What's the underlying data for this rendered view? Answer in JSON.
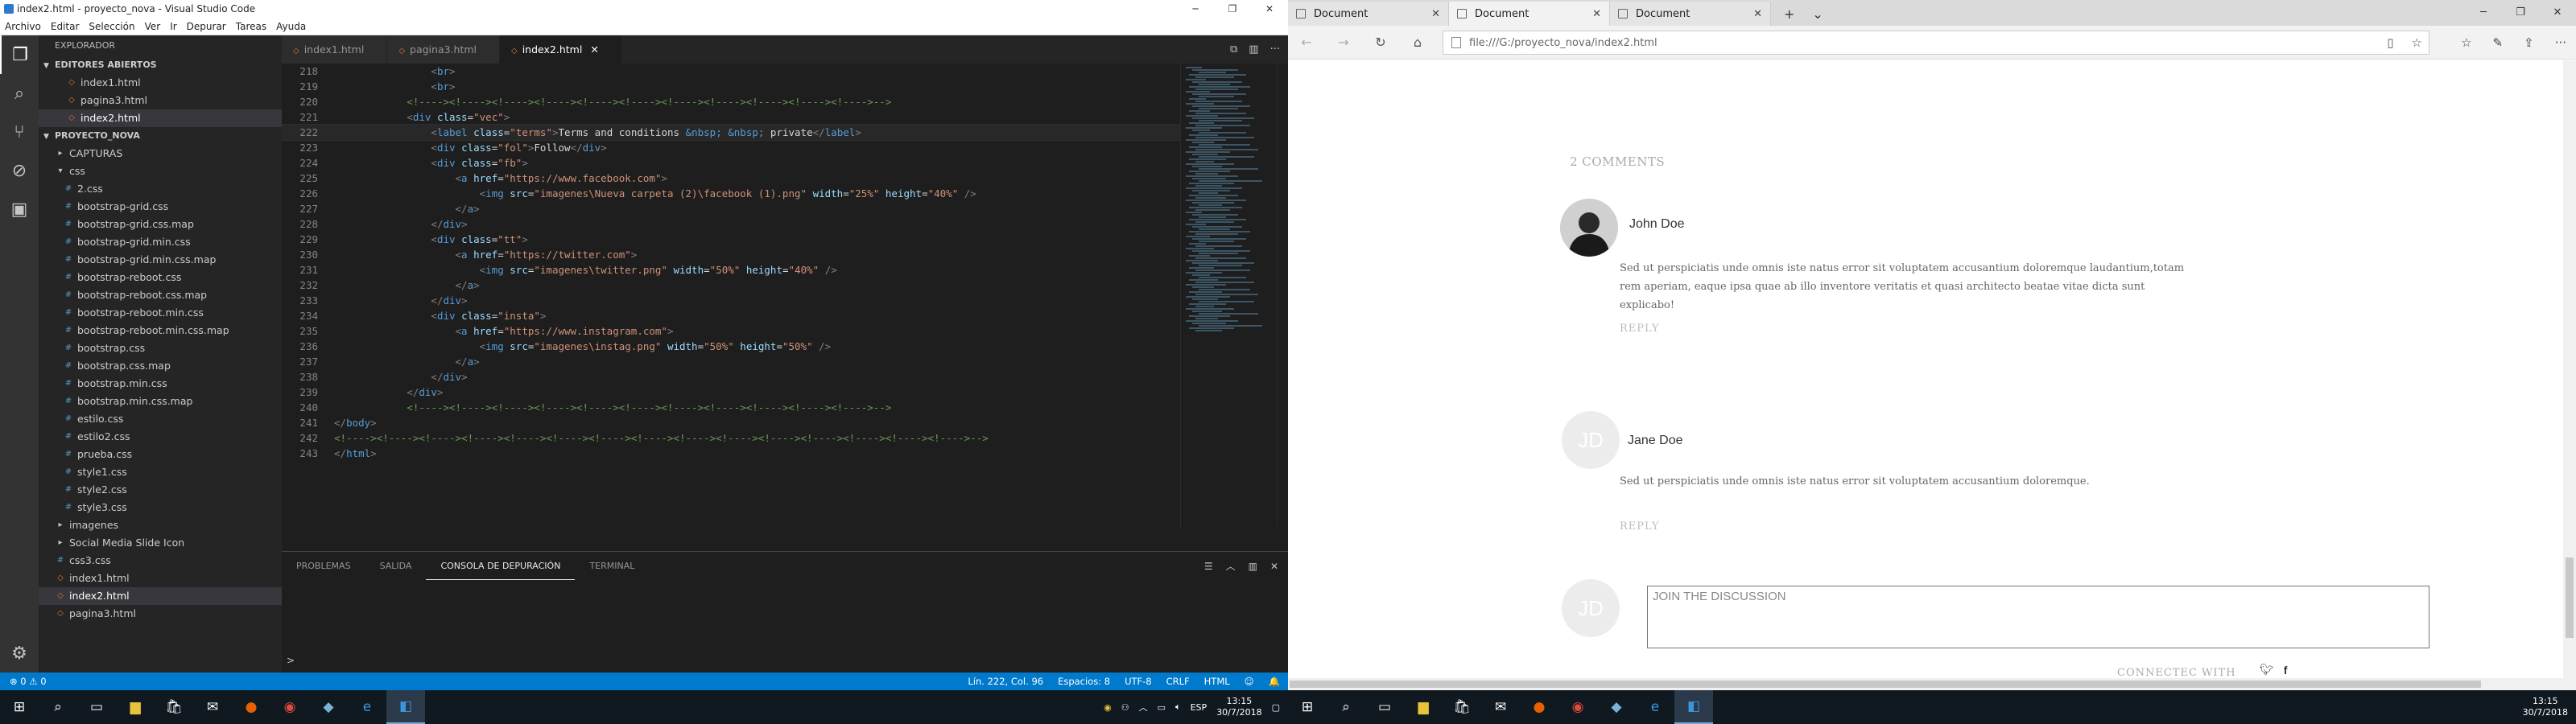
{
  "vscode": {
    "title": "index2.html - proyecto_nova - Visual Studio Code",
    "menu": [
      "Archivo",
      "Editar",
      "Selección",
      "Ver",
      "Ir",
      "Depurar",
      "Tareas",
      "Ayuda"
    ],
    "explorer_title": "EXPLORADOR",
    "open_editors_title": "EDITORES ABIERTOS",
    "open_editors": [
      "index1.html",
      "pagina3.html",
      "index2.html"
    ],
    "project_title": "PROYECTO_NOVA",
    "tree": [
      {
        "label": "CAPTURAS",
        "type": "dir",
        "depth": 1
      },
      {
        "label": "css",
        "type": "dir-open",
        "depth": 1
      },
      {
        "label": "2.css",
        "type": "css",
        "depth": 2
      },
      {
        "label": "bootstrap-grid.css",
        "type": "css",
        "depth": 2
      },
      {
        "label": "bootstrap-grid.css.map",
        "type": "css",
        "depth": 2
      },
      {
        "label": "bootstrap-grid.min.css",
        "type": "css",
        "depth": 2
      },
      {
        "label": "bootstrap-grid.min.css.map",
        "type": "css",
        "depth": 2
      },
      {
        "label": "bootstrap-reboot.css",
        "type": "css",
        "depth": 2
      },
      {
        "label": "bootstrap-reboot.css.map",
        "type": "css",
        "depth": 2
      },
      {
        "label": "bootstrap-reboot.min.css",
        "type": "css",
        "depth": 2
      },
      {
        "label": "bootstrap-reboot.min.css.map",
        "type": "css",
        "depth": 2
      },
      {
        "label": "bootstrap.css",
        "type": "css",
        "depth": 2
      },
      {
        "label": "bootstrap.css.map",
        "type": "css",
        "depth": 2
      },
      {
        "label": "bootstrap.min.css",
        "type": "css",
        "depth": 2
      },
      {
        "label": "bootstrap.min.css.map",
        "type": "css",
        "depth": 2
      },
      {
        "label": "estilo.css",
        "type": "css",
        "depth": 2
      },
      {
        "label": "estilo2.css",
        "type": "css",
        "depth": 2
      },
      {
        "label": "prueba.css",
        "type": "css",
        "depth": 2
      },
      {
        "label": "style1.css",
        "type": "css",
        "depth": 2
      },
      {
        "label": "style2.css",
        "type": "css",
        "depth": 2
      },
      {
        "label": "style3.css",
        "type": "css",
        "depth": 2
      },
      {
        "label": "imagenes",
        "type": "dir",
        "depth": 1
      },
      {
        "label": "Social Media Slide Icon",
        "type": "dir",
        "depth": 1
      },
      {
        "label": "css3.css",
        "type": "css",
        "depth": 1
      },
      {
        "label": "index1.html",
        "type": "html",
        "depth": 1
      },
      {
        "label": "index2.html",
        "type": "html",
        "depth": 1,
        "selected": true
      },
      {
        "label": "pagina3.html",
        "type": "html",
        "depth": 1
      }
    ],
    "tabs": [
      "index1.html",
      "pagina3.html",
      "index2.html"
    ],
    "active_tab": "index2.html",
    "code_lines": [
      {
        "n": "218",
        "html": "                <span class='t-punc'>&lt;</span><span class='t-tag'>br</span><span class='t-punc'>&gt;</span>"
      },
      {
        "n": "219",
        "html": "                <span class='t-punc'>&lt;</span><span class='t-tag'>br</span><span class='t-punc'>&gt;</span>"
      },
      {
        "n": "220",
        "html": "            <span class='t-com'>&lt;!----&gt;&lt;!----&gt;&lt;!----&gt;&lt;!----&gt;&lt;!----&gt;&lt;!----&gt;&lt;!----&gt;&lt;!----&gt;&lt;!----&gt;&lt;!----&gt;&lt;!----&gt;--&gt;</span>"
      },
      {
        "n": "221",
        "html": "            <span class='t-punc'>&lt;</span><span class='t-tag'>div</span> <span class='t-attr'>class</span>=<span class='t-str'>\"vec\"</span><span class='t-punc'>&gt;</span>"
      },
      {
        "n": "222",
        "html": "                <span class='t-punc'>&lt;</span><span class='t-tag'>label</span> <span class='t-attr'>class</span>=<span class='t-str'>\"terms\"</span><span class='t-punc'>&gt;</span>Terms and conditions <span class='t-ent'>&amp;nbsp;</span> <span class='t-ent'>&amp;nbsp;</span> private<span class='t-punc'>&lt;/</span><span class='t-tag'>label</span><span class='t-punc'>&gt;</span>",
        "cur": true
      },
      {
        "n": "223",
        "html": "                <span class='t-punc'>&lt;</span><span class='t-tag'>div</span> <span class='t-attr'>class</span>=<span class='t-str'>\"fol\"</span><span class='t-punc'>&gt;</span>Follow<span class='t-punc'>&lt;/</span><span class='t-tag'>div</span><span class='t-punc'>&gt;</span>"
      },
      {
        "n": "224",
        "html": "                <span class='t-punc'>&lt;</span><span class='t-tag'>div</span> <span class='t-attr'>class</span>=<span class='t-str'>\"fb\"</span><span class='t-punc'>&gt;</span>"
      },
      {
        "n": "225",
        "html": "                    <span class='t-punc'>&lt;</span><span class='t-tag'>a</span> <span class='t-attr'>href</span>=<span class='t-str'>\"https://www.facebook.com\"</span><span class='t-punc'>&gt;</span>"
      },
      {
        "n": "226",
        "html": "                        <span class='t-punc'>&lt;</span><span class='t-tag'>img</span> <span class='t-attr'>src</span>=<span class='t-str'>\"imagenes\\Nueva carpeta (2)\\facebook (1).png\"</span> <span class='t-attr'>width</span>=<span class='t-str'>\"25%\"</span> <span class='t-attr'>height</span>=<span class='t-str'>\"40%\"</span> <span class='t-punc'>/&gt;</span>"
      },
      {
        "n": "227",
        "html": "                    <span class='t-punc'>&lt;/</span><span class='t-tag'>a</span><span class='t-punc'>&gt;</span>"
      },
      {
        "n": "228",
        "html": "                <span class='t-punc'>&lt;/</span><span class='t-tag'>div</span><span class='t-punc'>&gt;</span>"
      },
      {
        "n": "229",
        "html": "                <span class='t-punc'>&lt;</span><span class='t-tag'>div</span> <span class='t-attr'>class</span>=<span class='t-str'>\"tt\"</span><span class='t-punc'>&gt;</span>"
      },
      {
        "n": "230",
        "html": "                    <span class='t-punc'>&lt;</span><span class='t-tag'>a</span> <span class='t-attr'>href</span>=<span class='t-str'>\"https://twitter.com\"</span><span class='t-punc'>&gt;</span>"
      },
      {
        "n": "231",
        "html": "                        <span class='t-punc'>&lt;</span><span class='t-tag'>img</span> <span class='t-attr'>src</span>=<span class='t-str'>\"imagenes\\twitter.png\"</span> <span class='t-attr'>width</span>=<span class='t-str'>\"50%\"</span> <span class='t-attr'>height</span>=<span class='t-str'>\"40%\"</span> <span class='t-punc'>/&gt;</span>"
      },
      {
        "n": "232",
        "html": "                    <span class='t-punc'>&lt;/</span><span class='t-tag'>a</span><span class='t-punc'>&gt;</span>"
      },
      {
        "n": "233",
        "html": "                <span class='t-punc'>&lt;/</span><span class='t-tag'>div</span><span class='t-punc'>&gt;</span>"
      },
      {
        "n": "234",
        "html": "                <span class='t-punc'>&lt;</span><span class='t-tag'>div</span> <span class='t-attr'>class</span>=<span class='t-str'>\"insta\"</span><span class='t-punc'>&gt;</span>"
      },
      {
        "n": "235",
        "html": "                    <span class='t-punc'>&lt;</span><span class='t-tag'>a</span> <span class='t-attr'>href</span>=<span class='t-str'>\"https://www.instagram.com\"</span><span class='t-punc'>&gt;</span>"
      },
      {
        "n": "236",
        "html": "                        <span class='t-punc'>&lt;</span><span class='t-tag'>img</span> <span class='t-attr'>src</span>=<span class='t-str'>\"imagenes\\instag.png\"</span> <span class='t-attr'>width</span>=<span class='t-str'>\"50%\"</span> <span class='t-attr'>height</span>=<span class='t-str'>\"50%\"</span> <span class='t-punc'>/&gt;</span>"
      },
      {
        "n": "237",
        "html": "                    <span class='t-punc'>&lt;/</span><span class='t-tag'>a</span><span class='t-punc'>&gt;</span>"
      },
      {
        "n": "238",
        "html": "                <span class='t-punc'>&lt;/</span><span class='t-tag'>div</span><span class='t-punc'>&gt;</span>"
      },
      {
        "n": "239",
        "html": "            <span class='t-punc'>&lt;/</span><span class='t-tag'>div</span><span class='t-punc'>&gt;</span>"
      },
      {
        "n": "240",
        "html": "            <span class='t-com'>&lt;!----&gt;&lt;!----&gt;&lt;!----&gt;&lt;!----&gt;&lt;!----&gt;&lt;!----&gt;&lt;!----&gt;&lt;!----&gt;&lt;!----&gt;&lt;!----&gt;&lt;!----&gt;--&gt;</span>"
      },
      {
        "n": "241",
        "html": "<span class='t-punc'>&lt;/</span><span class='t-tag'>body</span><span class='t-punc'>&gt;</span>"
      },
      {
        "n": "242",
        "html": "<span class='t-com'>&lt;!----&gt;&lt;!----&gt;&lt;!----&gt;&lt;!----&gt;&lt;!----&gt;&lt;!----&gt;&lt;!----&gt;&lt;!----&gt;&lt;!----&gt;&lt;!----&gt;&lt;!----&gt;&lt;!----&gt;&lt;!----&gt;&lt;!----&gt;&lt;!----&gt;--&gt;</span>"
      },
      {
        "n": "243",
        "html": "<span class='t-punc'>&lt;/</span><span class='t-tag'>html</span><span class='t-punc'>&gt;</span>"
      }
    ],
    "panel_tabs": [
      "PROBLEMAS",
      "SALIDA",
      "CONSOLA DE DEPURACIÓN",
      "TERMINAL"
    ],
    "panel_active": "CONSOLA DE DEPURACIÓN",
    "panel_prompt": ">",
    "status_left": "⊗ 0  ⚠ 0",
    "status_right": [
      "Lín. 222, Col. 96",
      "Espacios: 8",
      "UTF-8",
      "CRLF",
      "HTML",
      "☺",
      "🔔"
    ]
  },
  "edge": {
    "tabs": [
      "Document",
      "Document",
      "Document"
    ],
    "active_tab_index": 1,
    "url": "file:///G:/proyecto_nova/index2.html",
    "comments_count": "2 COMMENTS",
    "comments": [
      {
        "name": "John Doe",
        "text": "Sed ut perspiciatis unde omnis iste natus error sit voluptatem accusantium doloremque laudantium,totam rem aperiam, eaque ipsa quae ab illo inventore veritatis et quasi architecto beatae vitae dicta sunt explicabo!",
        "reply": "REPLY",
        "avatar": "photo"
      },
      {
        "name": "Jane Doe",
        "text": "Sed ut perspiciatis unde omnis iste natus error sit voluptatem accusantium doloremque.",
        "reply": "REPLY",
        "avatar": "JD"
      }
    ],
    "discussion_avatar": "JD",
    "discussion_placeholder": "JOIN THE DISCUSSION",
    "connect_label": "CONNECTEC WITH",
    "social_icons": [
      "twitter-icon",
      "facebook-icon"
    ]
  },
  "taskbar_left": {
    "time": "13:15",
    "date": "30/7/2018",
    "lang": "ESP"
  },
  "taskbar_right": {
    "time": "13:15",
    "date": "30/7/2018"
  }
}
